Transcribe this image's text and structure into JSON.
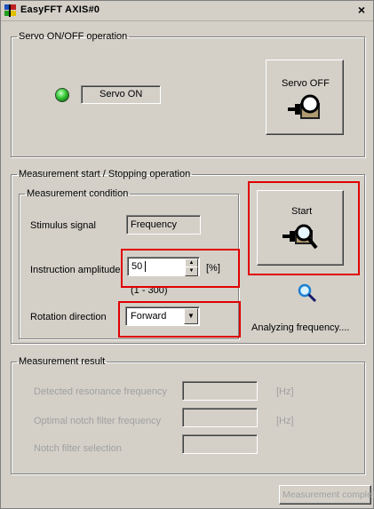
{
  "window": {
    "title": "EasyFFT AXIS#0",
    "close_glyph": "×"
  },
  "servo": {
    "group_label": "Servo ON/OFF operation",
    "status_text": "Servo ON",
    "led_color": "#2fbf2f",
    "button_label": "Servo OFF"
  },
  "measurement": {
    "group_label": "Measurement start / Stopping operation",
    "condition_label": "Measurement condition",
    "stimulus_label": "Stimulus signal",
    "stimulus_value": "Frequency",
    "amplitude_label": "Instruction amplitude",
    "amplitude_value": "50",
    "amplitude_unit": "[%]",
    "amplitude_range": "(1 - 300)",
    "rotation_label": "Rotation direction",
    "rotation_value": "Forward",
    "start_label": "Start",
    "status_text": "Analyzing frequency...."
  },
  "result": {
    "group_label": "Measurement result",
    "resonance_label": "Detected resonance frequency",
    "resonance_unit": "[Hz]",
    "notch_label": "Optimal notch filter frequency",
    "notch_unit": "[Hz]",
    "notch_selection_label": "Notch filter selection",
    "complete_label": "Measurement complete"
  },
  "colors": {
    "highlight": "#e00000",
    "window_bg": "#d4d0c8",
    "led": "#2fbf2f"
  }
}
